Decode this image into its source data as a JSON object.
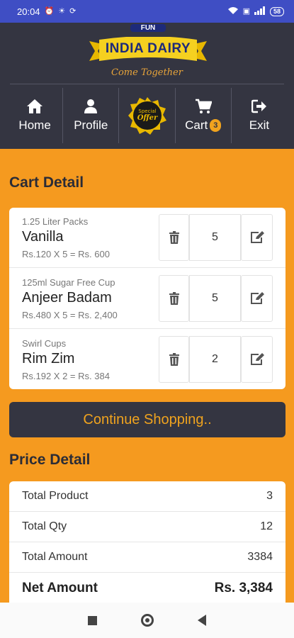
{
  "status_bar": {
    "time": "20:04",
    "battery": "58"
  },
  "brand": {
    "fun": "FUN",
    "name": "INDIA DAIRY",
    "tagline": "Come Together"
  },
  "nav": {
    "home": "Home",
    "profile": "Profile",
    "offer_line1": "Special",
    "offer_line2": "Offer",
    "cart": "Cart",
    "cart_count": "3",
    "exit": "Exit"
  },
  "cart": {
    "title": "Cart Detail",
    "items": [
      {
        "category": "1.25 Liter Packs",
        "name": "Vanilla",
        "price": "Rs.120 X 5 = Rs. 600",
        "qty": "5"
      },
      {
        "category": "125ml Sugar Free Cup",
        "name": "Anjeer Badam",
        "price": "Rs.480 X 5 = Rs. 2,400",
        "qty": "5"
      },
      {
        "category": "Swirl Cups",
        "name": "Rim Zim",
        "price": "Rs.192 X 2 = Rs. 384",
        "qty": "2"
      }
    ]
  },
  "continue_label": "Continue Shopping..",
  "price": {
    "title": "Price Detail",
    "rows": [
      {
        "label": "Total Product",
        "value": "3"
      },
      {
        "label": "Total Qty",
        "value": "12"
      },
      {
        "label": "Total Amount",
        "value": "3384"
      },
      {
        "label": "Net Amount",
        "value": "Rs. 3,384"
      }
    ]
  },
  "colors": {
    "header": "#343541",
    "accent": "#f59a1f",
    "statusbar": "#3f4ec4",
    "brand_yellow": "#f5d020"
  }
}
